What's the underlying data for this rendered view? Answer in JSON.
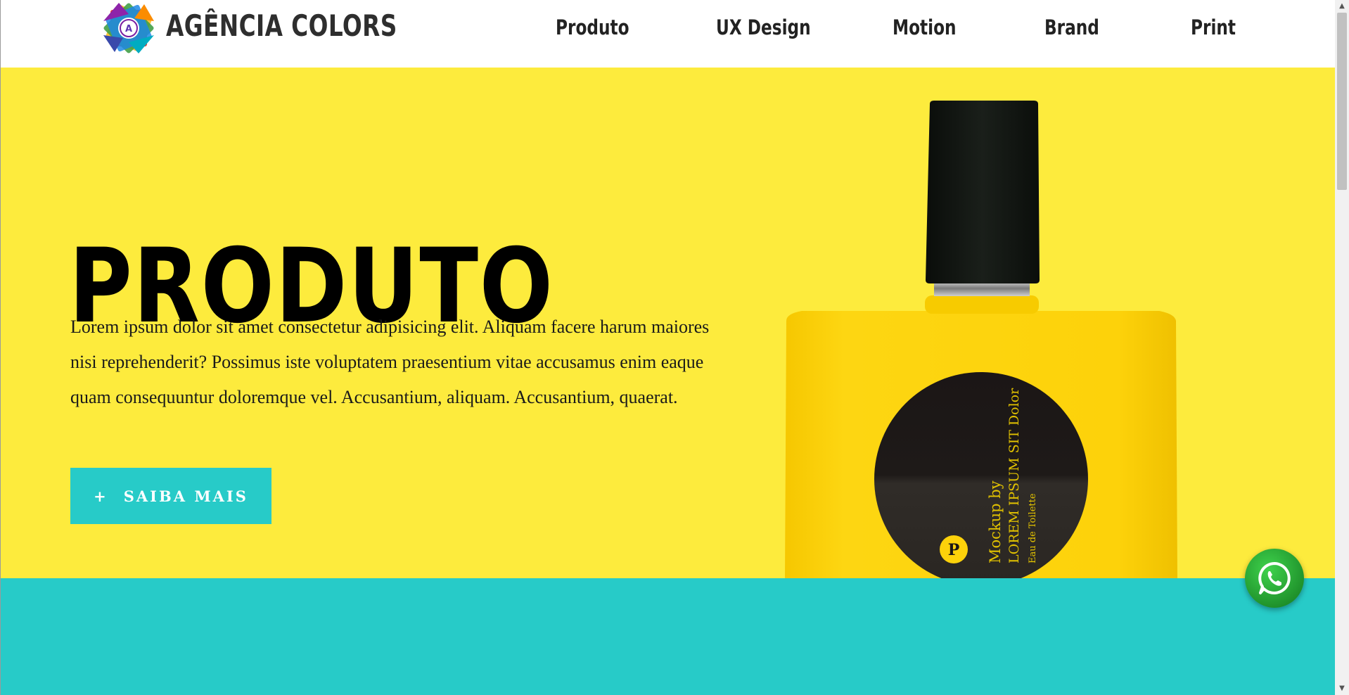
{
  "header": {
    "brand": "AGÊNCIA COLORS",
    "logo_letter": "A",
    "nav": [
      {
        "label": "Produto"
      },
      {
        "label": "UX Design"
      },
      {
        "label": "Motion"
      },
      {
        "label": "Brand"
      },
      {
        "label": "Print"
      }
    ]
  },
  "hero": {
    "title": "PRODUTO",
    "description": "Lorem ipsum dolor sit amet consectetur adipisicing elit. Aliquam facere harum maiores nisi reprehenderit? Possimus iste voluptatem praesentium vitae accusamus enim eaque quam consequuntur doloremque vel. Accusantium, aliquam. Accusantium, quaerat.",
    "cta_icon": "+",
    "cta_label": "SAIBA MAIS",
    "bottle_label": {
      "line1": "Mockup by",
      "line2": "LOREM IPSUM SIT Dolor",
      "line3": "Eau de Toilette",
      "badge": "P"
    }
  },
  "whatsapp": {
    "icon": "whatsapp-icon"
  },
  "colors": {
    "hero_bg": "#fdeb3d",
    "teal": "#27cbc8",
    "bottle_yellow": "#fdd20a",
    "cap": "#101410"
  }
}
